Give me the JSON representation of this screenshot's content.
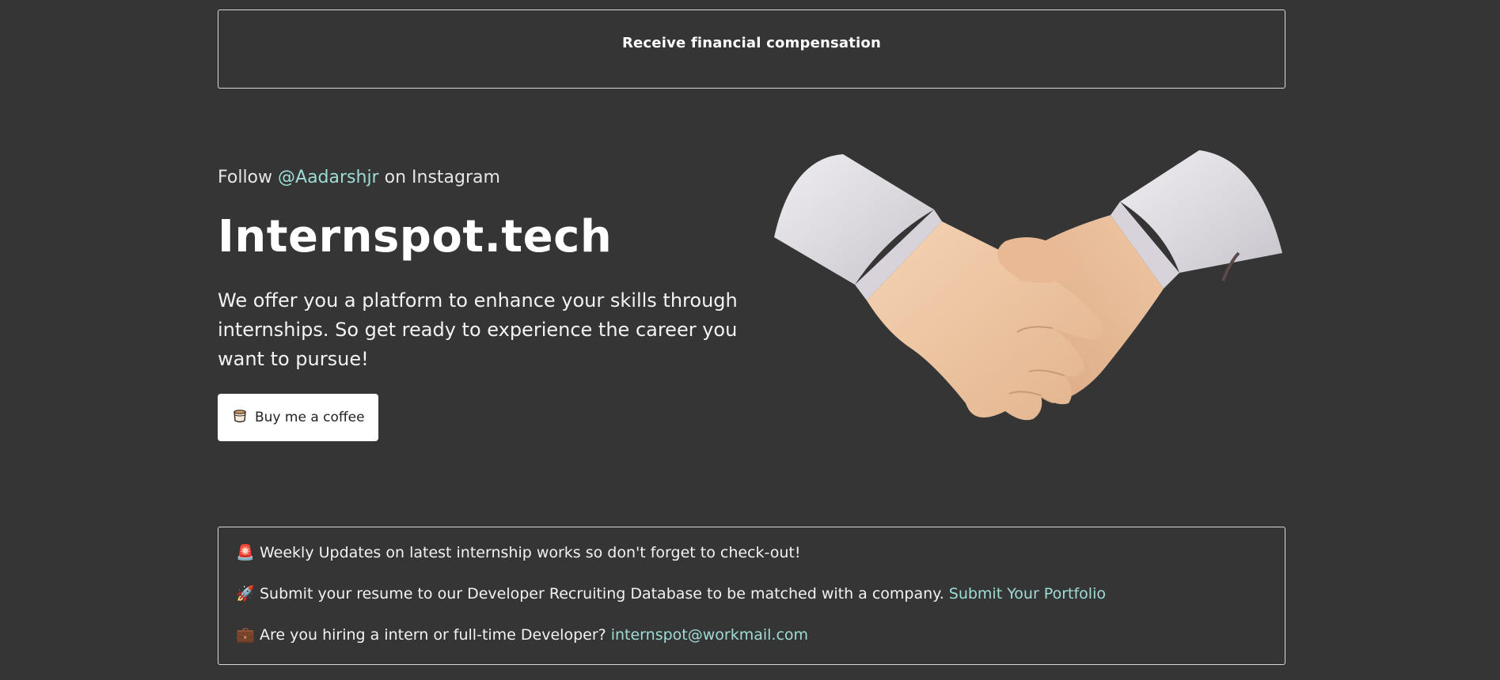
{
  "banner": {
    "text": "Receive financial compensation"
  },
  "hero": {
    "follow_prefix": "Follow",
    "follow_handle": "@Aadarshjr",
    "follow_suffix": "on Instagram",
    "title": "Internspot.tech",
    "tagline": "We offer you a platform to enhance your skills through internships. So get ready to experience the career you want to pursue!",
    "coffee_button": {
      "icon": "coffee-cup-icon",
      "label": "Buy me a coffee"
    },
    "illustration": "handshake"
  },
  "info": {
    "items": [
      {
        "icon": "siren-icon",
        "glyph": "🚨",
        "text": "Weekly Updates on latest internship works so don't forget to check-out!",
        "link": ""
      },
      {
        "icon": "rocket-icon",
        "glyph": "🚀",
        "text": "Submit your resume to our Developer Recruiting Database to be matched with a company.",
        "link": "Submit Your Portfolio"
      },
      {
        "icon": "briefcase-icon",
        "glyph": "💼",
        "text": "Are you hiring a intern or full-time Developer?",
        "link": "internspot@workmail.com"
      }
    ]
  },
  "colors": {
    "background": "#353535",
    "accent_link": "#9fdcd6",
    "border": "#d8d8d8"
  }
}
